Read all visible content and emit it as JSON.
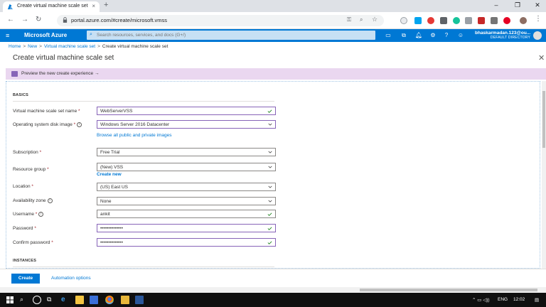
{
  "browser": {
    "tab_title": "Create virtual machine scale set",
    "tab_close": "×",
    "new_tab": "+",
    "url": "portal.azure.com/#create/microsoft.vmss",
    "controls": {
      "minimize": "–",
      "maximize": "❐",
      "close": "✕"
    }
  },
  "azure": {
    "menu_icon": "≡",
    "brand": "Microsoft Azure",
    "search_placeholder": "Search resources, services, and docs (G+/)",
    "user_name": "bhaskarmadan.123@ou...",
    "directory": "DEFAULT DIRECTORY"
  },
  "breadcrumb": {
    "home": "Home",
    "new": "New",
    "parent": "Virtual machine scale set",
    "current": "Create virtual machine scale set",
    "separator": ">"
  },
  "page": {
    "title": "Create virtual machine scale set",
    "close": "✕",
    "banner": "Preview the new create experience →"
  },
  "form": {
    "section_basics": "BASICS",
    "section_instances": "INSTANCES",
    "fields": {
      "name": {
        "label": "Virtual machine scale set name",
        "value": "WebServerVSS"
      },
      "os_image": {
        "label": "Operating system disk image",
        "value": "Windows Server 2016 Datacenter",
        "link": "Browse all public and private images"
      },
      "subscription": {
        "label": "Subscription",
        "value": "Free Trial"
      },
      "resource_group": {
        "label": "Resource group",
        "value": "(New) VSS",
        "link": "Create new"
      },
      "location": {
        "label": "Location",
        "value": "(US) East US"
      },
      "availability_zone": {
        "label": "Availability zone",
        "value": "None"
      },
      "username": {
        "label": "Username",
        "value": "ankit"
      },
      "password": {
        "label": "Password",
        "value": "••••••••••••••"
      },
      "confirm_password": {
        "label": "Confirm password",
        "value": "••••••••••••••"
      }
    },
    "required_mark": "*",
    "info_mark": "i"
  },
  "actions": {
    "create": "Create",
    "automation": "Automation options"
  },
  "taskbar": {
    "language": "ENG",
    "time": "12:02"
  },
  "colors": {
    "azure_blue": "#0078d4",
    "banner_purple": "#ead7f0",
    "active_border": "#8764b8",
    "valid_green": "#107c10"
  }
}
